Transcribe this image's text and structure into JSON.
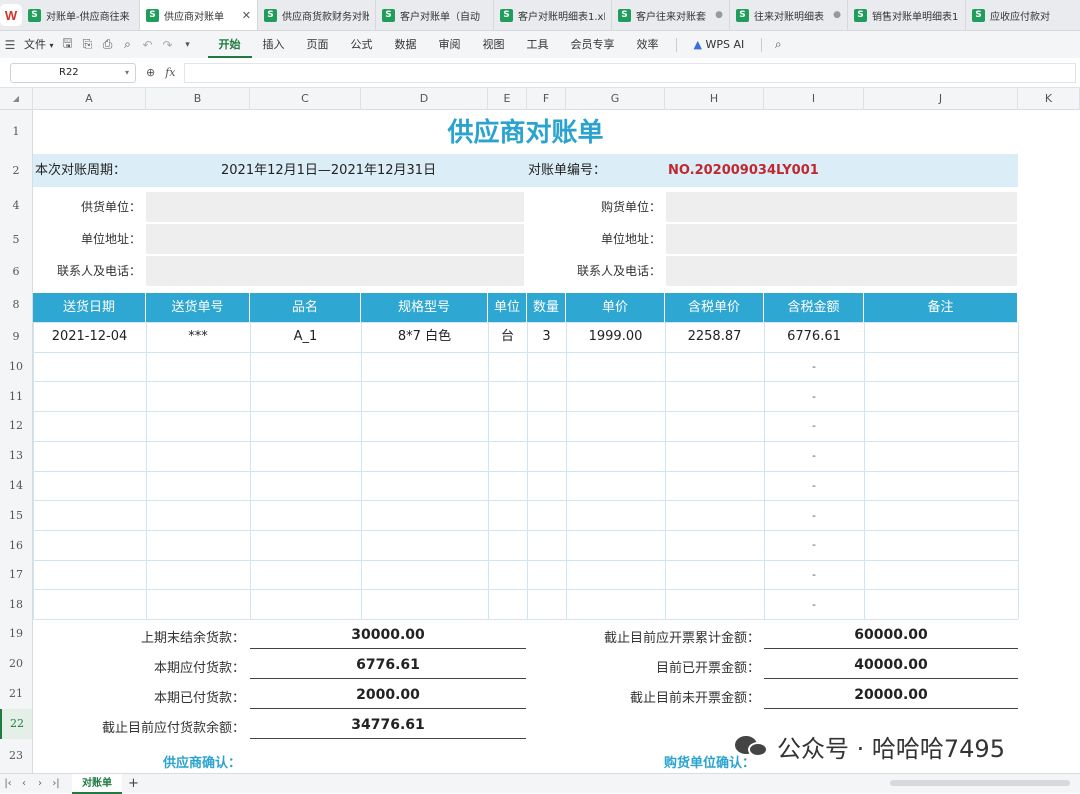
{
  "tabs": [
    {
      "label": "对账单-供应商往来",
      "active": false,
      "dot": false
    },
    {
      "label": "供应商对账单",
      "active": true,
      "dot": false
    },
    {
      "label": "供应商货款财务对账",
      "active": false,
      "dot": false
    },
    {
      "label": "客户对账单（自动",
      "active": false,
      "dot": false
    },
    {
      "label": "客户对账明细表1.xl",
      "active": false,
      "dot": false
    },
    {
      "label": "客户往来对账套",
      "active": false,
      "dot": true
    },
    {
      "label": "往来对账明细表",
      "active": false,
      "dot": true
    },
    {
      "label": "销售对账单明细表1",
      "active": false,
      "dot": false
    },
    {
      "label": "应收应付款对",
      "active": false,
      "dot": false
    }
  ],
  "menu": {
    "file": "文件",
    "items": [
      "开始",
      "插入",
      "页面",
      "公式",
      "数据",
      "审阅",
      "视图",
      "工具",
      "会员专享",
      "效率"
    ],
    "active_item": "开始",
    "wps_ai": "WPS AI"
  },
  "formula_bar": {
    "cell_ref": "R22",
    "fx": "fx",
    "value": ""
  },
  "columns": [
    "A",
    "B",
    "C",
    "D",
    "E",
    "F",
    "G",
    "H",
    "I",
    "J",
    "K"
  ],
  "rows": [
    "1",
    "2",
    "4",
    "5",
    "6",
    "8",
    "9",
    "10",
    "11",
    "12",
    "13",
    "14",
    "15",
    "16",
    "17",
    "18",
    "19",
    "20",
    "21",
    "22",
    "23"
  ],
  "selected_row": "22",
  "sheet": {
    "title": "供应商对账单",
    "period_label": "本次对账周期：",
    "period_value": "2021年12月1日—2021年12月31日",
    "number_label": "对账单编号：",
    "number_value": "NO.202009034LY001",
    "supplier_label": "供货单位：",
    "buyer_label": "购货单位：",
    "address_label_left": "单位地址：",
    "address_label_right": "单位地址：",
    "contact_label_left": "联系人及电话：",
    "contact_label_right": "联系人及电话：",
    "headers": [
      "送货日期",
      "送货单号",
      "品名",
      "规格型号",
      "单位",
      "数量",
      "单价",
      "含税单价",
      "含税金额",
      "备注"
    ],
    "row1": [
      "2021-12-04",
      "***",
      "A_1",
      "8*7 白色",
      "台",
      "3",
      "1999.00",
      "2258.87",
      "6776.61",
      ""
    ],
    "dash": "-",
    "summary_left": [
      {
        "label": "上期末结余货款：",
        "value": "30000.00"
      },
      {
        "label": "本期应付货款：",
        "value": "6776.61"
      },
      {
        "label": "本期已付货款：",
        "value": "2000.00"
      },
      {
        "label": "截止目前应付货款余额：",
        "value": "34776.61"
      }
    ],
    "summary_right": [
      {
        "label": "截止目前应开票累计金额：",
        "value": "60000.00"
      },
      {
        "label": "目前已开票金额：",
        "value": "40000.00"
      },
      {
        "label": "截止目前未开票金额：",
        "value": "20000.00"
      }
    ],
    "supplier_confirm": "供应商确认：",
    "buyer_confirm": "购货单位确认："
  },
  "watermark": "公众号 · 哈哈哈7495",
  "sheet_tab": "对账单",
  "colors": {
    "accent": "#2ea7d3",
    "title": "#2aa3cf",
    "band": "#dbeef7",
    "red": "#c0282f",
    "green": "#1f7a3f"
  }
}
